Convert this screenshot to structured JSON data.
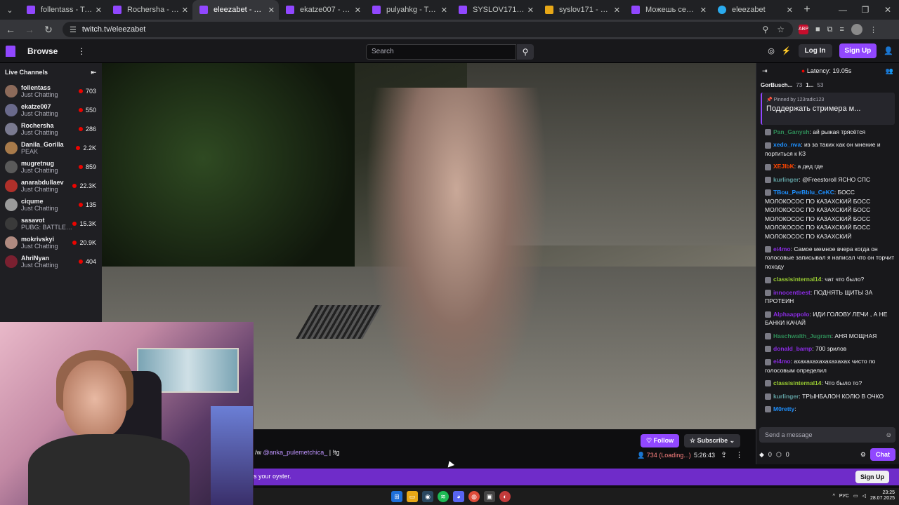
{
  "browser": {
    "tabs": [
      {
        "title": "follentass - Twitch",
        "kind": "twitch"
      },
      {
        "title": "Rochersha - Twitch",
        "kind": "twitch"
      },
      {
        "title": "eleezabet - Twitch",
        "kind": "twitch",
        "active": true
      },
      {
        "title": "ekatze007 - Twitch",
        "kind": "twitch"
      },
      {
        "title": "pulyahkg - Twitch",
        "kind": "twitch"
      },
      {
        "title": "SYSLOV171 - Twitch",
        "kind": "twitch"
      },
      {
        "title": "syslov171 - MemeAl",
        "kind": "meme"
      },
      {
        "title": "Можешь себе остан",
        "kind": "twitch"
      },
      {
        "title": "eleezabet",
        "kind": "tg"
      }
    ],
    "url": "twitch.tv/eleezabet",
    "abp_label": "ABP"
  },
  "topnav": {
    "browse": "Browse",
    "search_placeholder": "Search",
    "login": "Log In",
    "signup": "Sign Up"
  },
  "sidebar": {
    "heading": "Live Channels",
    "channels": [
      {
        "name": "follentass",
        "category": "Just Chatting",
        "viewers": "703",
        "color": "#8c6a5a"
      },
      {
        "name": "ekatze007",
        "category": "Just Chatting",
        "viewers": "550",
        "color": "#6a6a8c"
      },
      {
        "name": "Rochersha",
        "category": "Just Chatting",
        "viewers": "286",
        "color": "#7a7a90"
      },
      {
        "name": "Danila_Gorilla",
        "category": "PEAK",
        "viewers": "2.2K",
        "color": "#a87a4a"
      },
      {
        "name": "mugretnug",
        "category": "Just Chatting",
        "viewers": "859",
        "color": "#5a5a5a"
      },
      {
        "name": "anarabdullaev",
        "category": "Just Chatting",
        "viewers": "22.3K",
        "color": "#b0302a"
      },
      {
        "name": "ciqume",
        "category": "Just Chatting",
        "viewers": "135",
        "color": "#9a9a9a"
      },
      {
        "name": "sasavot",
        "category": "PUBG: BATTLEG...",
        "viewers": "15.3K",
        "color": "#3a3a3a"
      },
      {
        "name": "mokrivskyi",
        "category": "Just Chatting",
        "viewers": "20.9K",
        "color": "#b08a80"
      },
      {
        "name": "AhriNyan",
        "category": "Just Chatting",
        "viewers": "404",
        "color": "#7a2030"
      }
    ]
  },
  "stream": {
    "title_prefix": "/w ",
    "title_mention": "@anka_pulemetchica_",
    "title_suffix": " | !tg",
    "follow": "Follow",
    "subscribe": "Subscribe",
    "viewers": "734 (Loading...)",
    "uptime": "5:26:43"
  },
  "banner": {
    "text": "s your oyster.",
    "signup": "Sign Up"
  },
  "chat": {
    "latency": "Latency: 19.05s",
    "top_user": "GorBusch...",
    "top_count": "73",
    "top_user2": "1...",
    "top_count2": "53",
    "pinned_by": "Pinned by",
    "pinned_by_user": "123radic123",
    "pinned_msg": "Поддержать стримера м...",
    "messages": [
      {
        "user": "Pan_Ganysh",
        "color": "#2e8b57",
        "text": "ай рыжая трясётся"
      },
      {
        "user": "xedo_nva",
        "color": "#1e90ff",
        "text": "из за таких как он мнение и портиться к КЗ"
      },
      {
        "user": "XEJIbK",
        "color": "#ff4500",
        "text": "а дед где"
      },
      {
        "user": "kurlinger",
        "color": "#5f9ea0",
        "text": "@Freestoroll ЯСНО СПС"
      },
      {
        "user": "TBou_PerBblu_CeKC",
        "color": "#1e90ff",
        "text": "БОСС МОЛОКОСОС ПО КАЗАХСКИЙ БОСС МОЛОКОСОС ПО КАЗАХСКИЙ БОСС МОЛОКОСОС ПО КАЗАХСКИЙ БОСС МОЛОКОСОС ПО КАЗАХСКИЙ БОСС МОЛОКОСОС ПО КАЗАХСКИЙ"
      },
      {
        "user": "ei4mo",
        "color": "#8a2be2",
        "text": "Самое мемное вчера когда он голосовые записывал я написал что он торчит походу"
      },
      {
        "user": "classisinternal14",
        "color": "#9acd32",
        "text": "чат что было?"
      },
      {
        "user": "innocentbest",
        "color": "#8a2be2",
        "text": "ПОДНЯТЬ ЩИТЫ ЗА ПРОТЕИН"
      },
      {
        "user": "Alphaappolo",
        "color": "#8a2be2",
        "text": "ИДИ ГОЛОВУ ЛЕЧИ , А НЕ БАНКИ КАЧАЙ"
      },
      {
        "user": "Haschwalth_Jugram",
        "color": "#2e8b57",
        "text": "АНЯ МОЩНАЯ"
      },
      {
        "user": "donald_bamp",
        "color": "#8a2be2",
        "text": "700 зрилов"
      },
      {
        "user": "ei4mo",
        "color": "#8a2be2",
        "text": "ахахахахахахахахах чисто по голосовым определил"
      },
      {
        "user": "classisinternal14",
        "color": "#9acd32",
        "text": "Что было то?"
      },
      {
        "user": "kurlinger",
        "color": "#5f9ea0",
        "text": "ТРЫНБАЛОН КОЛЮ В ОЧКО"
      },
      {
        "user": "M0retty",
        "color": "#1e90ff",
        "text": ""
      }
    ],
    "input_placeholder": "Send a message",
    "points": "0",
    "points2": "0",
    "chat_btn": "Chat"
  },
  "taskbar": {
    "lang": "РУС",
    "time": "23:25",
    "date": "28.07.2025"
  }
}
